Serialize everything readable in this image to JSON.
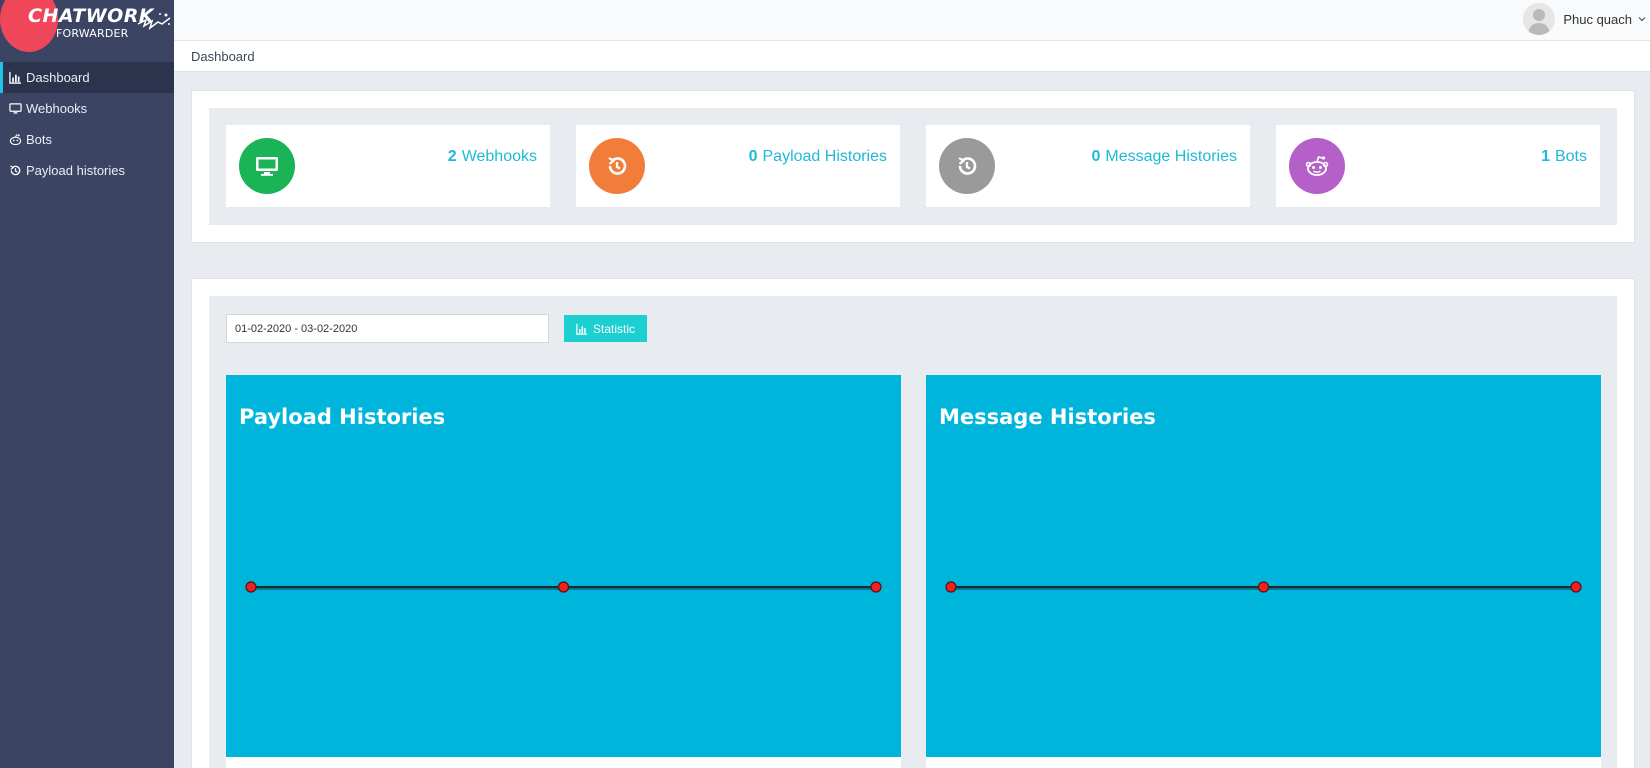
{
  "brand": {
    "line1": "CHATWORK",
    "line2": "FORWARDER"
  },
  "sidebar": {
    "items": [
      {
        "label": "Dashboard",
        "icon": "bar-chart-icon",
        "active": true
      },
      {
        "label": "Webhooks",
        "icon": "desktop-icon",
        "active": false
      },
      {
        "label": "Bots",
        "icon": "reddit-icon",
        "active": false
      },
      {
        "label": "Payload histories",
        "icon": "history-icon",
        "active": false
      }
    ]
  },
  "topbar": {
    "user_name": "Phuc quach"
  },
  "breadcrumb": {
    "current": "Dashboard"
  },
  "stats": [
    {
      "count": "2",
      "label": "Webhooks",
      "icon": "desktop-icon",
      "color": "#1ab355"
    },
    {
      "count": "0",
      "label": "Payload Histories",
      "icon": "history-icon",
      "color": "#f27d3b"
    },
    {
      "count": "0",
      "label": "Message Histories",
      "icon": "history-icon",
      "color": "#9a9a9a"
    },
    {
      "count": "1",
      "label": "Bots",
      "icon": "reddit-icon",
      "color": "#b55fc9"
    }
  ],
  "filter": {
    "date_range": "01-02-2020 - 03-02-2020",
    "button_label": "Statistic"
  },
  "colors": {
    "accent": "#1fb9d8",
    "chart_bg": "#00b5dc",
    "sidebar": "#3b4563",
    "point": "#f0201f"
  },
  "chart_data": [
    {
      "type": "line",
      "title": "Payload Histories",
      "x": [
        0,
        1,
        2
      ],
      "values": [
        0,
        0,
        0
      ]
    },
    {
      "type": "line",
      "title": "Message Histories",
      "x": [
        0,
        1,
        2
      ],
      "values": [
        0,
        0,
        0
      ]
    }
  ]
}
